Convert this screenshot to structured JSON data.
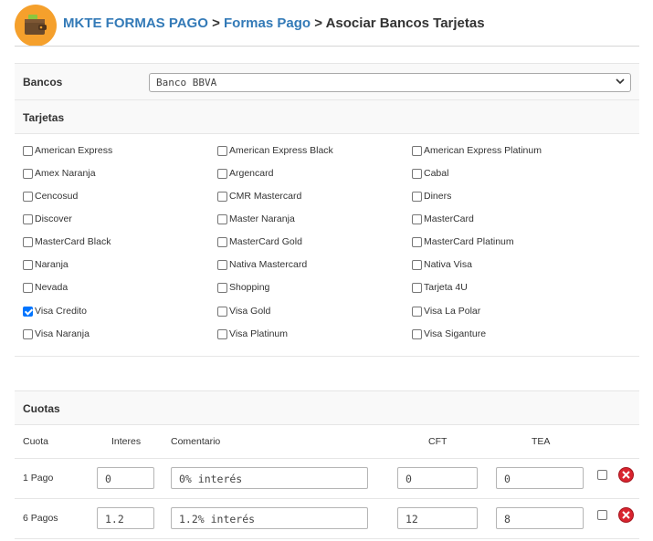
{
  "breadcrumb": {
    "root": "MKTE FORMAS PAGO",
    "section": "Formas Pago",
    "separator": ">",
    "current": "Asociar Bancos Tarjetas"
  },
  "bank": {
    "label": "Bancos",
    "selected": "Banco BBVA"
  },
  "cards_section": {
    "title": "Tarjetas",
    "items": [
      {
        "label": "American Express",
        "checked": false
      },
      {
        "label": "American Express Black",
        "checked": false
      },
      {
        "label": "American Express Platinum",
        "checked": false
      },
      {
        "label": "Amex Naranja",
        "checked": false
      },
      {
        "label": "Argencard",
        "checked": false
      },
      {
        "label": "Cabal",
        "checked": false
      },
      {
        "label": "Cencosud",
        "checked": false
      },
      {
        "label": "CMR Mastercard",
        "checked": false
      },
      {
        "label": "Diners",
        "checked": false
      },
      {
        "label": "Discover",
        "checked": false
      },
      {
        "label": "Master Naranja",
        "checked": false
      },
      {
        "label": "MasterCard",
        "checked": false
      },
      {
        "label": "MasterCard Black",
        "checked": false
      },
      {
        "label": "MasterCard Gold",
        "checked": false
      },
      {
        "label": "MasterCard Platinum",
        "checked": false
      },
      {
        "label": "Naranja",
        "checked": false
      },
      {
        "label": "Nativa Mastercard",
        "checked": false
      },
      {
        "label": "Nativa Visa",
        "checked": false
      },
      {
        "label": "Nevada",
        "checked": false
      },
      {
        "label": "Shopping",
        "checked": false
      },
      {
        "label": "Tarjeta 4U",
        "checked": false
      },
      {
        "label": "Visa Credito",
        "checked": true
      },
      {
        "label": "Visa Gold",
        "checked": false
      },
      {
        "label": "Visa La Polar",
        "checked": false
      },
      {
        "label": "Visa Naranja",
        "checked": false
      },
      {
        "label": "Visa Platinum",
        "checked": false
      },
      {
        "label": "Visa Siganture",
        "checked": false
      }
    ]
  },
  "cuotas": {
    "title": "Cuotas",
    "columns": {
      "cuota": "Cuota",
      "interes": "Interes",
      "comentario": "Comentario",
      "cft": "CFT",
      "tea": "TEA"
    },
    "rows": [
      {
        "cuota": "1 Pago",
        "interes": "0",
        "comentario": "0% interés",
        "cft": "0",
        "tea": "0",
        "checked": false
      },
      {
        "cuota": "6 Pagos",
        "interes": "1.2",
        "comentario": "1.2% interés",
        "cft": "12",
        "tea": "8",
        "checked": false
      }
    ]
  },
  "icons": {
    "logo": "wallet-icon",
    "dropdown": "chevron-down-icon",
    "delete": "delete-x-icon"
  },
  "colors": {
    "link": "#337ab7",
    "logo_bg": "#f5a02c",
    "delete": "#d9232e",
    "checkbox_checked": "#0075ff"
  }
}
